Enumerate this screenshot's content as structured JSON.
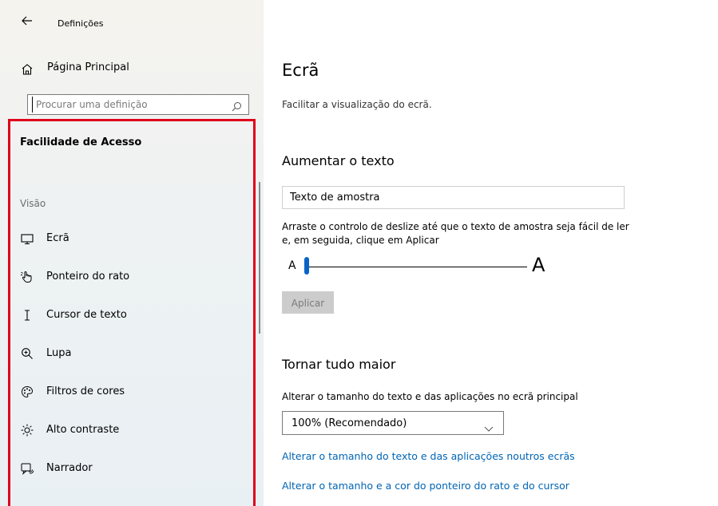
{
  "app": {
    "title": "Definições"
  },
  "sidebar": {
    "home_label": "Página Principal",
    "search_placeholder": "Procurar uma definição",
    "section_title": "Facilidade de Acesso",
    "category": "Visão",
    "items": [
      {
        "label": "Ecrã",
        "icon": "monitor-icon"
      },
      {
        "label": "Ponteiro do rato",
        "icon": "pointer-hand-icon"
      },
      {
        "label": "Cursor de texto",
        "icon": "text-cursor-icon"
      },
      {
        "label": "Lupa",
        "icon": "magnifier-icon"
      },
      {
        "label": "Filtros de cores",
        "icon": "color-palette-icon"
      },
      {
        "label": "Alto contraste",
        "icon": "sun-icon"
      },
      {
        "label": "Narrador",
        "icon": "narrator-icon"
      }
    ],
    "highlight_color": "#e0001b"
  },
  "main": {
    "title": "Ecrã",
    "subtitle": "Facilitar a visualização do ecrã.",
    "text_size": {
      "heading": "Aumentar o texto",
      "sample_text": "Texto de amostra",
      "instruction": "Arraste o controlo de deslize até que o texto de amostra seja fácil de ler e, em seguida, clique em Aplicar",
      "slider_min_label": "A",
      "slider_max_label": "A",
      "slider_value": 0,
      "apply_label": "Aplicar"
    },
    "scale": {
      "heading": "Tornar tudo maior",
      "label": "Alterar o tamanho do texto e das aplicações no ecrã principal",
      "selected": "100% (Recomendado)",
      "link_other_displays": "Alterar o tamanho do texto e das aplicações noutros ecrãs",
      "link_pointer": "Alterar o tamanho e a cor do ponteiro do rato e do cursor"
    },
    "accent_color": "#0a64c8",
    "link_color": "#0064b4"
  }
}
